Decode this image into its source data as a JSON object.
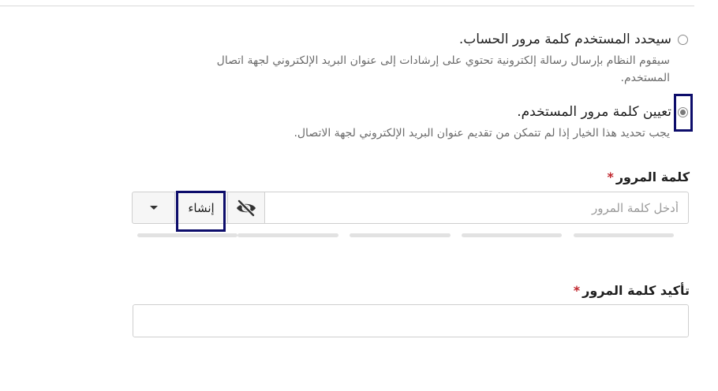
{
  "options": [
    {
      "label": "سيحدد المستخدم كلمة مرور الحساب.",
      "help": "سيقوم النظام بإرسال رسالة إلكترونية تحتوي على إرشادات إلى عنوان البريد الإلكتروني لجهة اتصال المستخدم.",
      "checked": false
    },
    {
      "label": "تعيين كلمة مرور المستخدم.",
      "help": "يجب تحديد هذا الخيار إذا لم تتمكن من تقديم عنوان البريد الإلكتروني لجهة الاتصال.",
      "checked": true
    }
  ],
  "password": {
    "label": "كلمة المرور",
    "required_mark": "*",
    "placeholder": "أدخل كلمة المرور",
    "generate_label": "إنشاء",
    "toggle_icon": "eye-slash-icon",
    "dropdown_icon": "caret-down-icon",
    "strength_level": 0
  },
  "confirm_password": {
    "label": "تأكيد كلمة المرور",
    "required_mark": "*",
    "placeholder": ""
  },
  "colors": {
    "required": "#c0262d",
    "highlight": "#0d0d6b"
  }
}
